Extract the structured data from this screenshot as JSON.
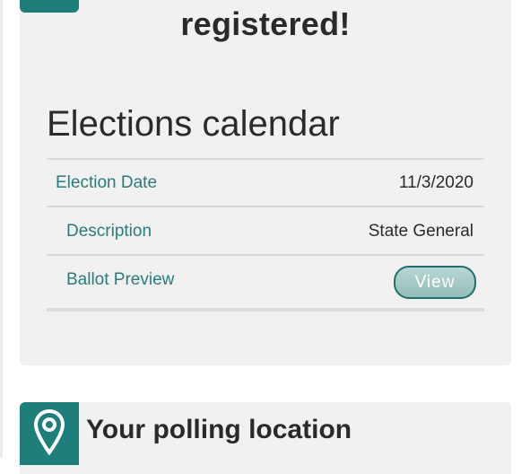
{
  "registration": {
    "heading_tail": "registered!"
  },
  "calendar": {
    "title": "Elections calendar",
    "rows": [
      {
        "label": "Election Date",
        "value": "11/3/2020"
      },
      {
        "label": "Description",
        "value": "State General"
      },
      {
        "label": "Ballot Preview",
        "button": "View"
      }
    ]
  },
  "polling": {
    "title": "Your polling location",
    "icon": "location-pin-icon"
  },
  "colors": {
    "accent": "#1e7f7a",
    "label_text": "#2a7b7c",
    "card_bg": "#f1f1f1"
  }
}
